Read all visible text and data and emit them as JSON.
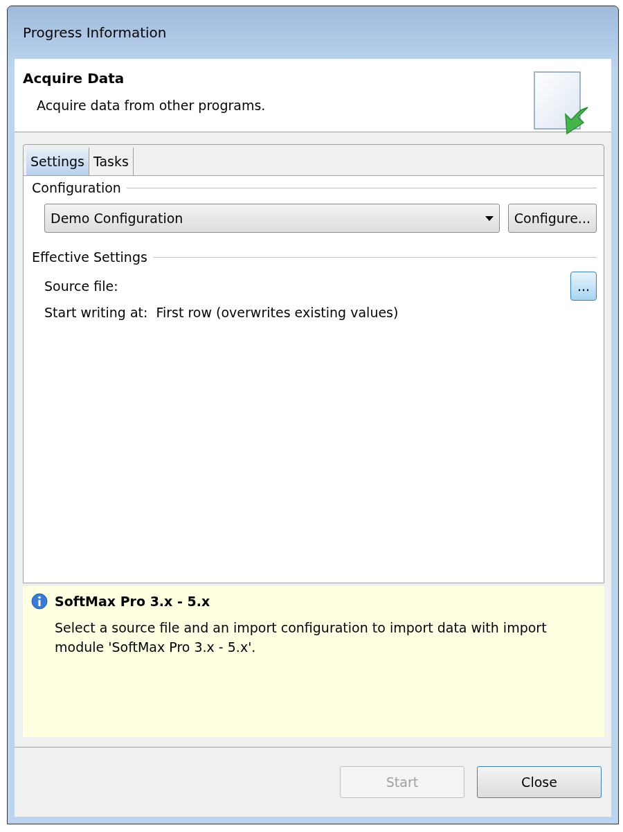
{
  "window": {
    "title": "Progress Information"
  },
  "header": {
    "title": "Acquire Data",
    "description": "Acquire data from other programs."
  },
  "tabs": [
    {
      "label": "Settings",
      "selected": true
    },
    {
      "label": "Tasks",
      "selected": false
    }
  ],
  "configuration": {
    "legend": "Configuration",
    "dropdown_value": "Demo Configuration",
    "configure_button": "Configure..."
  },
  "effective_settings": {
    "legend": "Effective Settings",
    "source_label": "Source file:",
    "browse_button": "...",
    "start_label": "Start writing at:",
    "start_value": "First row (overwrites existing values)"
  },
  "info": {
    "title": "SoftMax Pro 3.x - 5.x",
    "text": "Select a source file and an import configuration to import data with import module 'SoftMax Pro 3.x - 5.x'."
  },
  "buttons": [
    {
      "label": "Start",
      "disabled": true,
      "default": false
    },
    {
      "label": "Close",
      "disabled": false,
      "default": true
    }
  ]
}
